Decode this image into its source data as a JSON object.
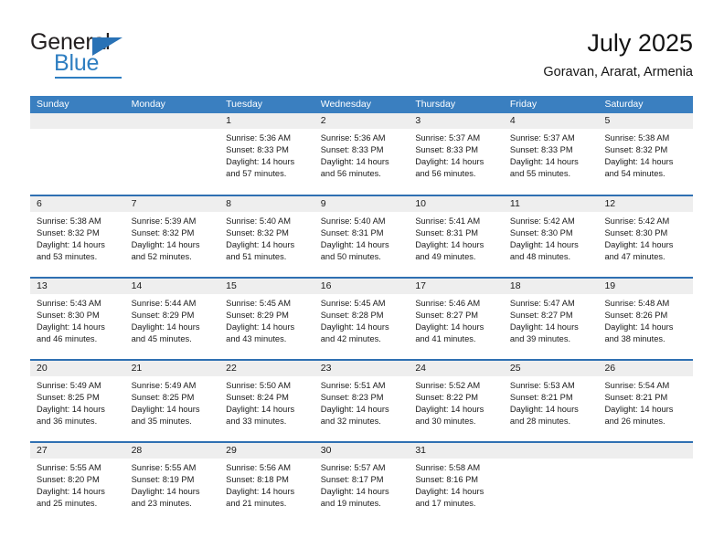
{
  "brand": {
    "name_top": "General",
    "name_bottom": "Blue",
    "triangle_icon": "triangle-icon",
    "accent_color": "#2e7ec1"
  },
  "header": {
    "title": "July 2025",
    "subtitle": "Goravan, Ararat, Armenia"
  },
  "calendar": {
    "header_color": "#3a7fc0",
    "row_divider_color": "#2f70b2",
    "day_band_color": "#eeeeee",
    "weekdays": [
      "Sunday",
      "Monday",
      "Tuesday",
      "Wednesday",
      "Thursday",
      "Friday",
      "Saturday"
    ],
    "weeks": [
      [
        {
          "day": "",
          "empty": true
        },
        {
          "day": "",
          "empty": true
        },
        {
          "day": "1",
          "sunrise": "Sunrise: 5:36 AM",
          "sunset": "Sunset: 8:33 PM",
          "daylight_1": "Daylight: 14 hours",
          "daylight_2": "and 57 minutes."
        },
        {
          "day": "2",
          "sunrise": "Sunrise: 5:36 AM",
          "sunset": "Sunset: 8:33 PM",
          "daylight_1": "Daylight: 14 hours",
          "daylight_2": "and 56 minutes."
        },
        {
          "day": "3",
          "sunrise": "Sunrise: 5:37 AM",
          "sunset": "Sunset: 8:33 PM",
          "daylight_1": "Daylight: 14 hours",
          "daylight_2": "and 56 minutes."
        },
        {
          "day": "4",
          "sunrise": "Sunrise: 5:37 AM",
          "sunset": "Sunset: 8:33 PM",
          "daylight_1": "Daylight: 14 hours",
          "daylight_2": "and 55 minutes."
        },
        {
          "day": "5",
          "sunrise": "Sunrise: 5:38 AM",
          "sunset": "Sunset: 8:32 PM",
          "daylight_1": "Daylight: 14 hours",
          "daylight_2": "and 54 minutes."
        }
      ],
      [
        {
          "day": "6",
          "sunrise": "Sunrise: 5:38 AM",
          "sunset": "Sunset: 8:32 PM",
          "daylight_1": "Daylight: 14 hours",
          "daylight_2": "and 53 minutes."
        },
        {
          "day": "7",
          "sunrise": "Sunrise: 5:39 AM",
          "sunset": "Sunset: 8:32 PM",
          "daylight_1": "Daylight: 14 hours",
          "daylight_2": "and 52 minutes."
        },
        {
          "day": "8",
          "sunrise": "Sunrise: 5:40 AM",
          "sunset": "Sunset: 8:32 PM",
          "daylight_1": "Daylight: 14 hours",
          "daylight_2": "and 51 minutes."
        },
        {
          "day": "9",
          "sunrise": "Sunrise: 5:40 AM",
          "sunset": "Sunset: 8:31 PM",
          "daylight_1": "Daylight: 14 hours",
          "daylight_2": "and 50 minutes."
        },
        {
          "day": "10",
          "sunrise": "Sunrise: 5:41 AM",
          "sunset": "Sunset: 8:31 PM",
          "daylight_1": "Daylight: 14 hours",
          "daylight_2": "and 49 minutes."
        },
        {
          "day": "11",
          "sunrise": "Sunrise: 5:42 AM",
          "sunset": "Sunset: 8:30 PM",
          "daylight_1": "Daylight: 14 hours",
          "daylight_2": "and 48 minutes."
        },
        {
          "day": "12",
          "sunrise": "Sunrise: 5:42 AM",
          "sunset": "Sunset: 8:30 PM",
          "daylight_1": "Daylight: 14 hours",
          "daylight_2": "and 47 minutes."
        }
      ],
      [
        {
          "day": "13",
          "sunrise": "Sunrise: 5:43 AM",
          "sunset": "Sunset: 8:30 PM",
          "daylight_1": "Daylight: 14 hours",
          "daylight_2": "and 46 minutes."
        },
        {
          "day": "14",
          "sunrise": "Sunrise: 5:44 AM",
          "sunset": "Sunset: 8:29 PM",
          "daylight_1": "Daylight: 14 hours",
          "daylight_2": "and 45 minutes."
        },
        {
          "day": "15",
          "sunrise": "Sunrise: 5:45 AM",
          "sunset": "Sunset: 8:29 PM",
          "daylight_1": "Daylight: 14 hours",
          "daylight_2": "and 43 minutes."
        },
        {
          "day": "16",
          "sunrise": "Sunrise: 5:45 AM",
          "sunset": "Sunset: 8:28 PM",
          "daylight_1": "Daylight: 14 hours",
          "daylight_2": "and 42 minutes."
        },
        {
          "day": "17",
          "sunrise": "Sunrise: 5:46 AM",
          "sunset": "Sunset: 8:27 PM",
          "daylight_1": "Daylight: 14 hours",
          "daylight_2": "and 41 minutes."
        },
        {
          "day": "18",
          "sunrise": "Sunrise: 5:47 AM",
          "sunset": "Sunset: 8:27 PM",
          "daylight_1": "Daylight: 14 hours",
          "daylight_2": "and 39 minutes."
        },
        {
          "day": "19",
          "sunrise": "Sunrise: 5:48 AM",
          "sunset": "Sunset: 8:26 PM",
          "daylight_1": "Daylight: 14 hours",
          "daylight_2": "and 38 minutes."
        }
      ],
      [
        {
          "day": "20",
          "sunrise": "Sunrise: 5:49 AM",
          "sunset": "Sunset: 8:25 PM",
          "daylight_1": "Daylight: 14 hours",
          "daylight_2": "and 36 minutes."
        },
        {
          "day": "21",
          "sunrise": "Sunrise: 5:49 AM",
          "sunset": "Sunset: 8:25 PM",
          "daylight_1": "Daylight: 14 hours",
          "daylight_2": "and 35 minutes."
        },
        {
          "day": "22",
          "sunrise": "Sunrise: 5:50 AM",
          "sunset": "Sunset: 8:24 PM",
          "daylight_1": "Daylight: 14 hours",
          "daylight_2": "and 33 minutes."
        },
        {
          "day": "23",
          "sunrise": "Sunrise: 5:51 AM",
          "sunset": "Sunset: 8:23 PM",
          "daylight_1": "Daylight: 14 hours",
          "daylight_2": "and 32 minutes."
        },
        {
          "day": "24",
          "sunrise": "Sunrise: 5:52 AM",
          "sunset": "Sunset: 8:22 PM",
          "daylight_1": "Daylight: 14 hours",
          "daylight_2": "and 30 minutes."
        },
        {
          "day": "25",
          "sunrise": "Sunrise: 5:53 AM",
          "sunset": "Sunset: 8:21 PM",
          "daylight_1": "Daylight: 14 hours",
          "daylight_2": "and 28 minutes."
        },
        {
          "day": "26",
          "sunrise": "Sunrise: 5:54 AM",
          "sunset": "Sunset: 8:21 PM",
          "daylight_1": "Daylight: 14 hours",
          "daylight_2": "and 26 minutes."
        }
      ],
      [
        {
          "day": "27",
          "sunrise": "Sunrise: 5:55 AM",
          "sunset": "Sunset: 8:20 PM",
          "daylight_1": "Daylight: 14 hours",
          "daylight_2": "and 25 minutes."
        },
        {
          "day": "28",
          "sunrise": "Sunrise: 5:55 AM",
          "sunset": "Sunset: 8:19 PM",
          "daylight_1": "Daylight: 14 hours",
          "daylight_2": "and 23 minutes."
        },
        {
          "day": "29",
          "sunrise": "Sunrise: 5:56 AM",
          "sunset": "Sunset: 8:18 PM",
          "daylight_1": "Daylight: 14 hours",
          "daylight_2": "and 21 minutes."
        },
        {
          "day": "30",
          "sunrise": "Sunrise: 5:57 AM",
          "sunset": "Sunset: 8:17 PM",
          "daylight_1": "Daylight: 14 hours",
          "daylight_2": "and 19 minutes."
        },
        {
          "day": "31",
          "sunrise": "Sunrise: 5:58 AM",
          "sunset": "Sunset: 8:16 PM",
          "daylight_1": "Daylight: 14 hours",
          "daylight_2": "and 17 minutes."
        },
        {
          "day": "",
          "empty": true
        },
        {
          "day": "",
          "empty": true
        }
      ]
    ]
  }
}
